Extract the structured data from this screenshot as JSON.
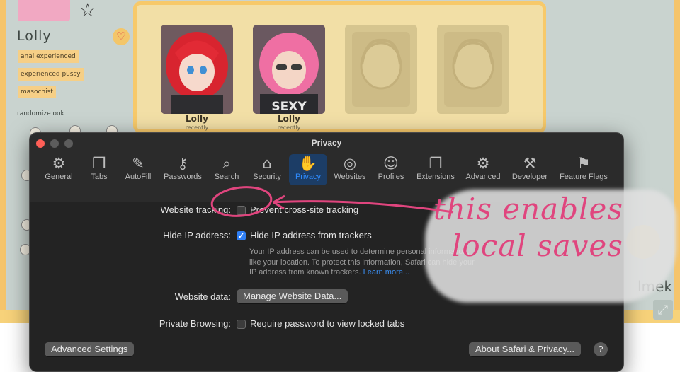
{
  "background_app": {
    "character_name": "Lolly",
    "tags": [
      "anal experienced",
      "experienced pussy",
      "masochist"
    ],
    "randomize_label": "randomize ook",
    "cards": [
      {
        "name": "Lolly",
        "subtitle": "recently",
        "style": "red"
      },
      {
        "name": "Lolly",
        "subtitle": "recently",
        "style": "pink"
      },
      {
        "name": "",
        "subtitle": "",
        "style": "empty"
      },
      {
        "name": "",
        "subtitle": "",
        "style": "empty"
      }
    ],
    "watermark_text": "lmek",
    "icons": [
      "heart-icon",
      "fullscreen-icon"
    ]
  },
  "window": {
    "title": "Privacy",
    "toolbar": [
      {
        "id": "general",
        "label": "General",
        "icon": "gear-icon"
      },
      {
        "id": "tabs",
        "label": "Tabs",
        "icon": "tabs-icon"
      },
      {
        "id": "autofill",
        "label": "AutoFill",
        "icon": "autofill-icon"
      },
      {
        "id": "passwords",
        "label": "Passwords",
        "icon": "key-icon"
      },
      {
        "id": "search",
        "label": "Search",
        "icon": "search-icon"
      },
      {
        "id": "security",
        "label": "Security",
        "icon": "lock-icon"
      },
      {
        "id": "privacy",
        "label": "Privacy",
        "icon": "hand-icon",
        "active": true
      },
      {
        "id": "websites",
        "label": "Websites",
        "icon": "globe-icon"
      },
      {
        "id": "profiles",
        "label": "Profiles",
        "icon": "person-icon"
      },
      {
        "id": "extensions",
        "label": "Extensions",
        "icon": "puzzle-icon"
      },
      {
        "id": "advanced",
        "label": "Advanced",
        "icon": "gears-icon"
      },
      {
        "id": "developer",
        "label": "Developer",
        "icon": "tools-icon"
      },
      {
        "id": "feature-flags",
        "label": "Feature Flags",
        "icon": "flags-icon"
      }
    ],
    "website_tracking": {
      "label": "Website tracking:",
      "option": "Prevent cross-site tracking",
      "checked": false
    },
    "hide_ip": {
      "label": "Hide IP address:",
      "option": "Hide IP address from trackers",
      "checked": true,
      "info_line1": "Your IP address can be used to determine personal information,",
      "info_line2": "like your location. To protect this information, Safari can hide your",
      "info_line3": "IP address from known trackers.",
      "learn_more": "Learn more..."
    },
    "website_data": {
      "label": "Website data:",
      "button": "Manage Website Data..."
    },
    "private_browsing": {
      "label": "Private Browsing:",
      "option": "Require password to view locked tabs",
      "checked": false
    },
    "footer": {
      "advanced_settings": "Advanced Settings",
      "about": "About Safari & Privacy...",
      "help": "?"
    }
  },
  "annotation": {
    "line1": "this enables",
    "line2": "local saves",
    "color": "#e0457e"
  },
  "colors": {
    "accent": "#2f7ff5",
    "active_tab_bg": "#1c3d66",
    "close_button": "#fe5f57"
  }
}
